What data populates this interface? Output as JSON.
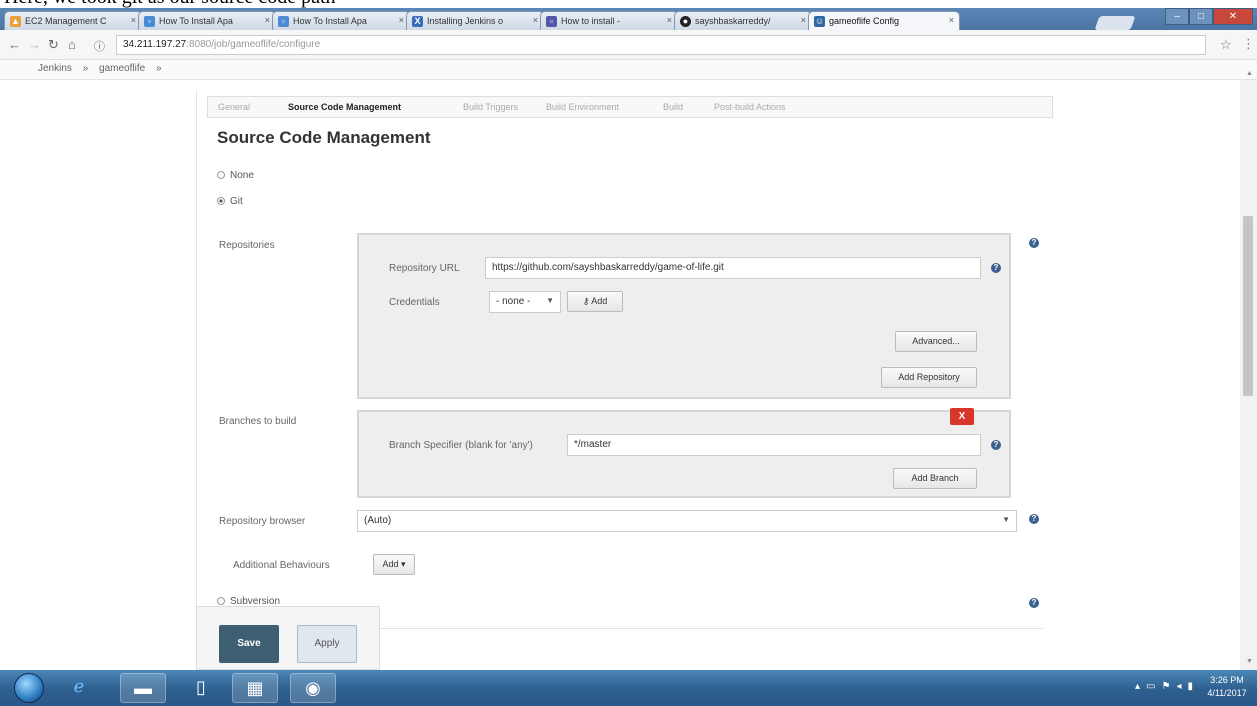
{
  "caption": "Here, we took git as our source code path",
  "browser": {
    "tabs": [
      {
        "label": "EC2 Management C",
        "icon": "aws-icon",
        "color": "#e8a03a",
        "active": false
      },
      {
        "label": "How To Install Apa",
        "icon": "page-icon",
        "color": "#4a8bd6",
        "active": false
      },
      {
        "label": "How To Install Apa",
        "icon": "page-icon",
        "color": "#4a8bd6",
        "active": false
      },
      {
        "label": "Installing Jenkins o",
        "icon": "x-icon",
        "color": "#3a6fb7",
        "active": false
      },
      {
        "label": "How to install -",
        "icon": "page-icon",
        "color": "#55a",
        "active": false
      },
      {
        "label": "sayshbaskarreddy/",
        "icon": "github-icon",
        "color": "#222",
        "active": false
      },
      {
        "label": "gameoflife Config",
        "icon": "jenkins-icon",
        "color": "#2d6aa3",
        "active": true
      }
    ],
    "url_host": "34.211.197.27",
    "url_path": ":8080/job/gameoflife/configure"
  },
  "breadcrumb": [
    "Jenkins",
    "»",
    "gameoflife",
    "»"
  ],
  "subtabs": [
    {
      "label": "General",
      "active": false
    },
    {
      "label": "Source Code Management",
      "active": true
    },
    {
      "label": "Build Triggers",
      "active": false
    },
    {
      "label": "Build Environment",
      "active": false
    },
    {
      "label": "Build",
      "active": false
    },
    {
      "label": "Post-build Actions",
      "active": false
    }
  ],
  "section_title": "Source Code Management",
  "scm": {
    "none_label": "None",
    "git_label": "Git",
    "selected": "Git",
    "repositories_label": "Repositories",
    "repo_url_label": "Repository URL",
    "repo_url_value": "https://github.com/sayshbaskarreddy/game-of-life.git",
    "credentials_label": "Credentials",
    "credentials_value": "- none -",
    "add_credentials_label": "Add",
    "advanced_label": "Advanced...",
    "add_repository_label": "Add Repository",
    "branches_label": "Branches to build",
    "branch_specifier_label": "Branch Specifier (blank for 'any')",
    "branch_specifier_value": "*/master",
    "remove_branch_label": "X",
    "add_branch_label": "Add Branch",
    "repo_browser_label": "Repository browser",
    "repo_browser_value": "(Auto)",
    "additional_behaviours_label": "Additional Behaviours",
    "add_behaviour_label": "Add",
    "subversion_label": "Subversion"
  },
  "actions": {
    "save_label": "Save",
    "apply_label": "Apply"
  },
  "taskbar": {
    "time": "3:26 PM",
    "date": "4/11/2017"
  }
}
